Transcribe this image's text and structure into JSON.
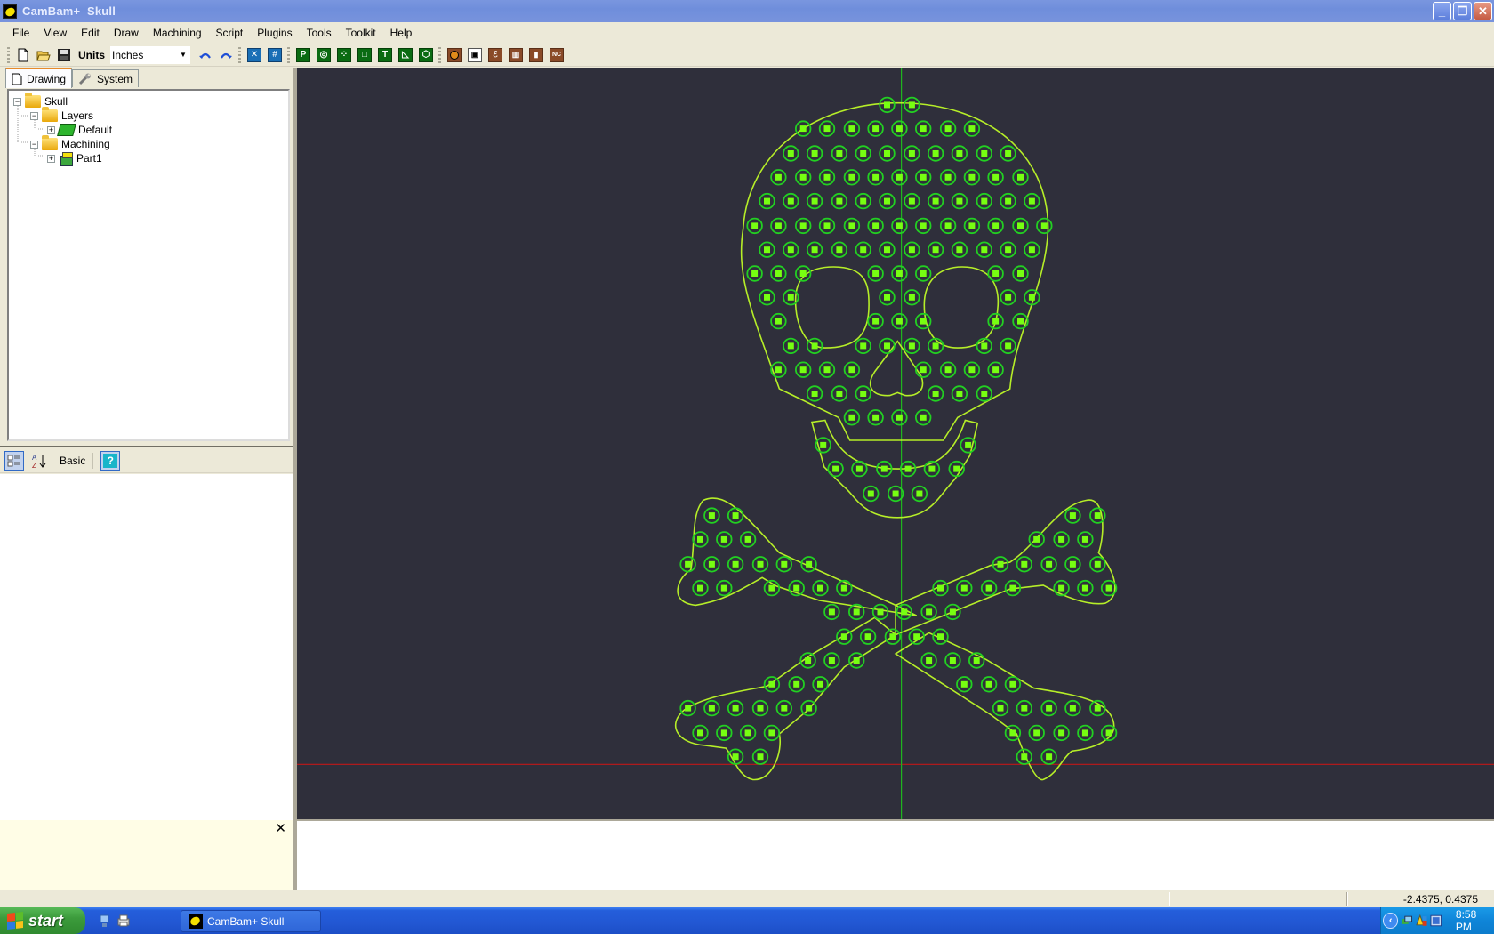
{
  "window": {
    "app_name": "CamBam+",
    "document_name": "Skull",
    "buttons": {
      "minimize": "_",
      "restore": "❐",
      "close": "✕"
    }
  },
  "menu": [
    "File",
    "View",
    "Edit",
    "Draw",
    "Machining",
    "Script",
    "Plugins",
    "Tools",
    "Toolkit",
    "Help"
  ],
  "toolbar": {
    "units_label": "Units",
    "units_value": "Inches",
    "buttons": [
      {
        "name": "new-file",
        "icon": "new-file-icon"
      },
      {
        "name": "open-file",
        "icon": "open-folder-icon"
      },
      {
        "name": "save-file",
        "icon": "save-icon"
      },
      {
        "name": "undo",
        "icon": "undo-icon"
      },
      {
        "name": "redo",
        "icon": "redo-icon"
      },
      {
        "name": "snap-to-points",
        "icon": "snap-icon"
      },
      {
        "name": "snap-to-grid",
        "icon": "grid-icon"
      },
      {
        "name": "draw-polyline",
        "icon": "polyline-icon",
        "glyph": "P"
      },
      {
        "name": "draw-circle",
        "icon": "circle-icon"
      },
      {
        "name": "draw-points",
        "icon": "points-icon"
      },
      {
        "name": "draw-rectangle",
        "icon": "rectangle-icon"
      },
      {
        "name": "draw-text",
        "icon": "text-icon",
        "glyph": "T"
      },
      {
        "name": "draw-arc",
        "icon": "arc-icon"
      },
      {
        "name": "draw-surface",
        "icon": "surface-icon"
      },
      {
        "name": "op-drill",
        "icon": "drill-icon"
      },
      {
        "name": "op-profile",
        "icon": "profile-icon"
      },
      {
        "name": "op-pocket",
        "icon": "pocket-icon"
      },
      {
        "name": "op-engrave",
        "icon": "engrave-icon"
      },
      {
        "name": "op-3d-profile",
        "icon": "3d-profile-icon"
      },
      {
        "name": "op-nc-file",
        "icon": "nc-file-icon",
        "glyph": "NC"
      }
    ]
  },
  "left_panel": {
    "tabs": [
      {
        "label": "Drawing",
        "icon": "document-icon",
        "active": true
      },
      {
        "label": "System",
        "icon": "wrench-icon",
        "active": false
      }
    ],
    "tree": [
      {
        "label": "Skull",
        "level": 0,
        "expander": "−",
        "icon": "folder-icon"
      },
      {
        "label": "Layers",
        "level": 1,
        "expander": "−",
        "icon": "folder-icon"
      },
      {
        "label": "Default",
        "level": 2,
        "expander": "+",
        "icon": "layer-icon"
      },
      {
        "label": "Machining",
        "level": 1,
        "expander": "−",
        "icon": "folder-icon"
      },
      {
        "label": "Part1",
        "level": 2,
        "expander": "+",
        "icon": "part-icon"
      }
    ],
    "property_toolbar": {
      "categorized": "categorized-icon",
      "alphabetical": "sort-az-icon",
      "mode_label": "Basic",
      "help": "?"
    }
  },
  "log_panel": {
    "close": "✕",
    "text": ""
  },
  "canvas": {
    "background": "#2f2f3b",
    "outline_color": "#b6ee28",
    "hole_color": "#22d022",
    "hole_center_color": "#77ff11",
    "x_axis_color": "#c01818",
    "y_axis_color": "#1fb51f"
  },
  "statusbar": {
    "coordinates": "-2.4375, 0.4375"
  },
  "taskbar": {
    "start_label": "start",
    "task_button_label": "CamBam+  Skull",
    "clock": "8:58 PM"
  }
}
